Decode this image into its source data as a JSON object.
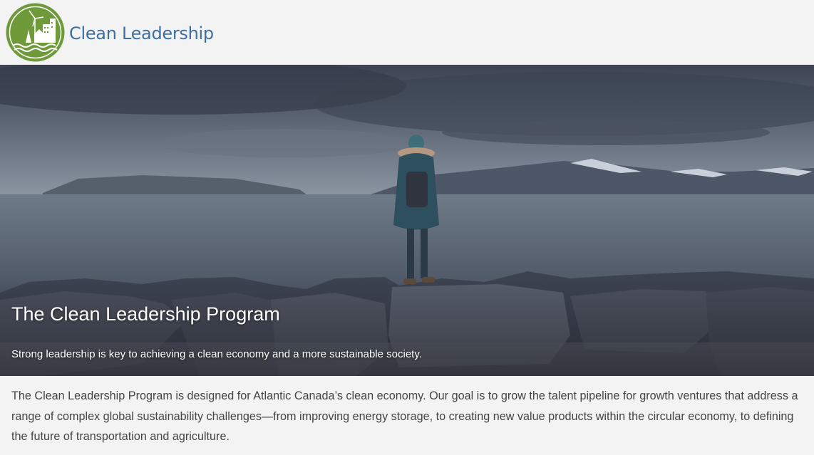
{
  "header": {
    "logo_text": "Clean Leadership",
    "colors": {
      "logo_green": "#6f9a3a",
      "logo_text": "#3d6fa3"
    }
  },
  "hero": {
    "title": "The Clean Leadership Program",
    "subtitle": "Strong leadership is key to achieving a clean economy and a more sustainable society.",
    "image_alt": "Person with a backpack standing on rocks facing the sea and snowy mountains"
  },
  "intro": {
    "text": "The Clean Leadership Program is designed for Atlantic Canada’s clean economy. Our goal is to grow the talent pipeline for growth ventures that address a range of complex global sustainability challenges—from improving energy storage, to creating new value products within the circular economy, to defining the future of transportation and agriculture."
  }
}
